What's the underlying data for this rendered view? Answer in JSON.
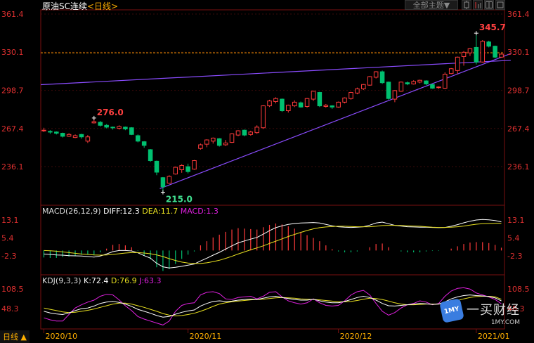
{
  "header": {
    "title": "原油SC连续",
    "period": "<日线>"
  },
  "toolbar": {
    "theme_button": "全部主题▼"
  },
  "footer": {
    "period_tab": "日线 ▲"
  },
  "colors": {
    "up": "#ff3b3b",
    "down": "#00c070",
    "diff": "#ffffff",
    "dea": "#e8e020",
    "j": "#e020e0",
    "trend": "#8a4cff",
    "ref": "#ff9a00"
  },
  "chart_data": {
    "type": "candlestick",
    "price_ticks": [
      "361.4",
      "330.1",
      "298.7",
      "267.4",
      "236.1"
    ],
    "ref_level": 329.6,
    "annotations": [
      {
        "id": "hi1",
        "label": "276.0",
        "value": 276.0
      },
      {
        "id": "lo",
        "label": "215.0",
        "value": 215.0
      },
      {
        "id": "hi2",
        "label": "345.7",
        "value": 345.7
      }
    ],
    "x_labels": [
      "2020/10",
      "2020/11",
      "2020/12",
      "2021/01"
    ],
    "candles": [
      [
        265.5,
        266.0,
        268.0,
        264.5
      ],
      [
        265.0,
        264.5,
        266.0,
        263.0
      ],
      [
        264.5,
        263.5,
        265.0,
        262.5
      ],
      [
        263.5,
        261.0,
        264.0,
        260.0
      ],
      [
        261.0,
        262.5,
        263.5,
        260.5
      ],
      [
        260.0,
        261.5,
        262.5,
        259.5
      ],
      [
        262.5,
        260.5,
        263.0,
        259.0
      ],
      [
        257.0,
        260.5,
        262.0,
        255.5
      ],
      [
        272.0,
        273.0,
        276.0,
        271.5
      ],
      [
        272.5,
        270.0,
        273.5,
        269.0
      ],
      [
        270.0,
        268.5,
        271.0,
        267.5
      ],
      [
        268.5,
        268.0,
        269.0,
        266.5
      ],
      [
        267.5,
        269.0,
        270.0,
        266.5
      ],
      [
        268.5,
        267.0,
        269.0,
        266.0
      ],
      [
        268.0,
        262.5,
        268.5,
        262.0
      ],
      [
        261.5,
        257.0,
        262.5,
        256.0
      ],
      [
        256.5,
        253.5,
        257.0,
        251.5
      ],
      [
        250.0,
        241.0,
        250.5,
        240.0
      ],
      [
        240.5,
        231.5,
        241.0,
        229.0
      ],
      [
        227.0,
        219.5,
        227.5,
        215.0
      ],
      [
        222.5,
        228.0,
        229.0,
        222.0
      ],
      [
        230.0,
        235.5,
        236.0,
        229.5
      ],
      [
        233.5,
        237.0,
        238.0,
        231.0
      ],
      [
        236.0,
        232.0,
        238.5,
        230.5
      ],
      [
        234.0,
        241.0,
        241.5,
        233.5
      ],
      [
        251.0,
        254.0,
        255.0,
        250.0
      ],
      [
        254.5,
        258.0,
        258.5,
        252.0
      ],
      [
        257.0,
        259.5,
        260.0,
        255.0
      ],
      [
        259.0,
        253.5,
        259.5,
        252.5
      ],
      [
        254.0,
        255.5,
        258.0,
        253.0
      ],
      [
        256.0,
        263.0,
        263.5,
        255.5
      ],
      [
        262.0,
        265.5,
        266.0,
        261.0
      ],
      [
        266.0,
        262.0,
        266.5,
        261.0
      ],
      [
        262.5,
        264.5,
        265.5,
        261.5
      ],
      [
        264.0,
        268.5,
        270.0,
        263.0
      ],
      [
        268.0,
        286.0,
        286.5,
        267.0
      ],
      [
        286.0,
        290.0,
        291.0,
        285.0
      ],
      [
        289.5,
        292.0,
        293.0,
        288.0
      ],
      [
        291.5,
        282.0,
        292.0,
        281.0
      ],
      [
        282.0,
        286.5,
        287.0,
        280.5
      ],
      [
        286.0,
        289.0,
        290.5,
        285.0
      ],
      [
        288.5,
        285.0,
        289.5,
        284.5
      ],
      [
        285.5,
        292.0,
        292.5,
        284.5
      ],
      [
        291.5,
        298.0,
        298.5,
        290.0
      ],
      [
        297.0,
        286.0,
        297.5,
        285.0
      ],
      [
        285.5,
        286.5,
        287.5,
        284.5
      ],
      [
        286.0,
        285.0,
        286.5,
        283.5
      ],
      [
        285.0,
        289.0,
        289.5,
        284.5
      ],
      [
        289.0,
        292.5,
        293.0,
        288.0
      ],
      [
        292.0,
        297.0,
        297.5,
        291.0
      ],
      [
        296.5,
        300.0,
        301.0,
        295.5
      ],
      [
        300.0,
        303.5,
        304.0,
        299.0
      ],
      [
        303.0,
        310.0,
        310.5,
        302.5
      ],
      [
        309.5,
        314.0,
        314.5,
        308.5
      ],
      [
        314.0,
        305.0,
        315.0,
        304.0
      ],
      [
        305.5,
        292.0,
        306.0,
        291.0
      ],
      [
        291.5,
        298.5,
        299.0,
        289.0
      ],
      [
        298.0,
        305.5,
        306.0,
        297.5
      ],
      [
        305.0,
        304.0,
        306.0,
        303.0
      ],
      [
        304.0,
        306.0,
        307.0,
        303.5
      ],
      [
        305.5,
        307.0,
        307.5,
        304.5
      ],
      [
        306.5,
        304.0,
        307.0,
        303.0
      ],
      [
        303.5,
        300.5,
        304.0,
        300.0
      ],
      [
        301.0,
        301.5,
        302.0,
        300.0
      ],
      [
        300.5,
        312.0,
        313.5,
        300.0
      ],
      [
        312.5,
        316.5,
        317.0,
        312.0
      ],
      [
        315.0,
        326.0,
        326.5,
        312.0
      ],
      [
        326.5,
        330.0,
        331.0,
        319.0
      ],
      [
        329.5,
        333.0,
        333.5,
        327.0
      ],
      [
        334.0,
        322.0,
        344.0,
        320.0
      ],
      [
        322.0,
        339.0,
        340.0,
        321.5
      ],
      [
        338.5,
        335.0,
        339.5,
        334.0
      ],
      [
        335.0,
        326.0,
        335.5,
        325.0
      ],
      [
        326.0,
        328.5,
        329.0,
        325.5
      ]
    ],
    "macd": {
      "label": "MACD(26,12,9)",
      "values": {
        "diff": "DIFF:12.3",
        "dea": "DEA:11.7",
        "macd": "MACD:1.3"
      },
      "ticks": [
        "13.1",
        "5.4",
        "-2.3"
      ],
      "diff": [
        -1.5,
        -1.7,
        -1.9,
        -2.0,
        -2.2,
        -2.3,
        -2.4,
        -2.6,
        -2.8,
        -2.4,
        -1.5,
        -0.5,
        0.0,
        0.0,
        -0.2,
        -1.0,
        -2.2,
        -3.3,
        -5.5,
        -7.0,
        -7.5,
        -7.2,
        -6.8,
        -6.3,
        -5.8,
        -4.5,
        -3.3,
        -2.0,
        -0.8,
        0.6,
        2.0,
        3.3,
        4.1,
        4.9,
        5.6,
        7.0,
        8.5,
        9.8,
        10.6,
        11.2,
        11.6,
        11.8,
        11.9,
        12.0,
        11.8,
        11.2,
        10.6,
        10.2,
        10.0,
        9.9,
        10.0,
        10.2,
        10.9,
        11.8,
        12.2,
        11.5,
        10.8,
        10.5,
        10.2,
        10.1,
        10.0,
        10.0,
        9.9,
        9.8,
        9.9,
        10.4,
        11.1,
        11.9,
        12.6,
        13.1,
        13.3,
        13.2,
        12.9,
        12.3
      ],
      "dea": [
        0.0,
        -0.1,
        -0.3,
        -0.6,
        -0.9,
        -1.2,
        -1.5,
        -1.7,
        -1.9,
        -2.0,
        -1.9,
        -1.7,
        -1.4,
        -1.1,
        -0.9,
        -0.9,
        -1.1,
        -1.4,
        -1.9,
        -2.6,
        -3.5,
        -4.3,
        -5.0,
        -5.4,
        -5.6,
        -5.6,
        -5.3,
        -4.8,
        -4.2,
        -3.4,
        -2.5,
        -1.5,
        -0.6,
        0.3,
        1.1,
        2.0,
        3.0,
        4.0,
        5.0,
        6.0,
        6.9,
        7.8,
        8.6,
        9.3,
        9.8,
        10.1,
        10.3,
        10.4,
        10.4,
        10.3,
        10.2,
        10.2,
        10.2,
        10.4,
        10.7,
        10.8,
        10.8,
        10.7,
        10.6,
        10.5,
        10.4,
        10.2,
        10.0,
        9.9,
        9.9,
        10.0,
        10.2,
        10.5,
        10.9,
        11.3,
        11.5,
        11.6,
        11.7,
        11.7
      ]
    },
    "kdj": {
      "label": "KDJ(9,3,3)",
      "values": {
        "k": "K:72.4",
        "d": "D:76.9",
        "j": "J:63.3"
      },
      "ticks": [
        "108.5",
        "48.3"
      ],
      "k": [
        40,
        35,
        32,
        30,
        35,
        42,
        48,
        50,
        56,
        64,
        68,
        70,
        67,
        62,
        55,
        46,
        40,
        34,
        27,
        22,
        24,
        31,
        37,
        41,
        44,
        56,
        64,
        70,
        72,
        70,
        71,
        74,
        76,
        77,
        76,
        80,
        84,
        86,
        82,
        79,
        76,
        74,
        74,
        77,
        72,
        68,
        66,
        66,
        70,
        76,
        82,
        86,
        82,
        74,
        64,
        57,
        56,
        58,
        60,
        62,
        64,
        63,
        61,
        62,
        69,
        78,
        84,
        88,
        90,
        88,
        87,
        85,
        81,
        72
      ],
      "d": [
        50,
        46,
        42,
        38,
        36,
        37,
        40,
        43,
        47,
        52,
        57,
        62,
        65,
        65,
        62,
        57,
        52,
        46,
        40,
        33,
        28,
        26,
        27,
        30,
        34,
        40,
        47,
        55,
        62,
        66,
        69,
        71,
        73,
        75,
        76,
        77,
        79,
        81,
        82,
        81,
        80,
        78,
        77,
        76,
        75,
        73,
        71,
        69,
        69,
        70,
        73,
        77,
        80,
        79,
        76,
        71,
        66,
        62,
        60,
        60,
        61,
        62,
        62,
        62,
        64,
        68,
        73,
        78,
        82,
        85,
        86,
        86,
        84,
        77
      ],
      "j": [
        20,
        14,
        10,
        10,
        30,
        50,
        60,
        68,
        74,
        86,
        92,
        90,
        75,
        57,
        42,
        24,
        16,
        10,
        4,
        -2,
        10,
        40,
        58,
        64,
        66,
        90,
        98,
        100,
        94,
        78,
        76,
        82,
        84,
        86,
        78,
        86,
        98,
        100,
        84,
        72,
        66,
        62,
        66,
        78,
        66,
        58,
        56,
        58,
        72,
        90,
        100,
        104,
        90,
        64,
        40,
        28,
        36,
        50,
        60,
        64,
        72,
        68,
        60,
        64,
        86,
        102,
        110,
        112,
        108,
        96,
        90,
        84,
        76,
        63
      ]
    }
  }
}
